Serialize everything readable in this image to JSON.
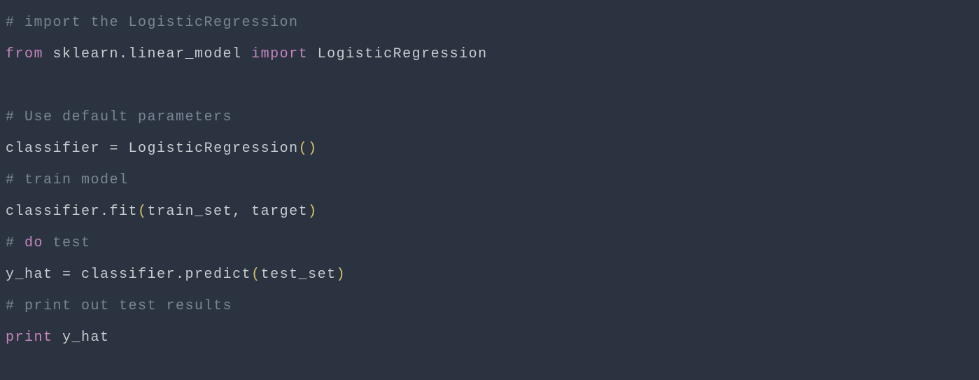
{
  "code": {
    "line1_comment": "# import the LogisticRegression",
    "line2_from": "from",
    "line2_module": " sklearn.linear_model ",
    "line2_import": "import",
    "line2_class": " LogisticRegression",
    "line4_comment": "# Use default parameters",
    "line5_lhs": "classifier ",
    "line5_eq": "=",
    "line5_rhs": " LogisticRegression",
    "line5_paren_open": "(",
    "line5_paren_close": ")",
    "line6_comment": "# train model",
    "line7_call": "classifier.fit",
    "line7_paren_open": "(",
    "line7_args": "train_set, target",
    "line7_paren_close": ")",
    "line8_hash": "# ",
    "line8_do": "do",
    "line8_test": " test",
    "line9_lhs": "y_hat ",
    "line9_eq": "=",
    "line9_rhs": " classifier.predict",
    "line9_paren_open": "(",
    "line9_args": "test_set",
    "line9_paren_close": ")",
    "line10_comment": "# print out test results",
    "line11_print": "print",
    "line11_arg": " y_hat"
  }
}
